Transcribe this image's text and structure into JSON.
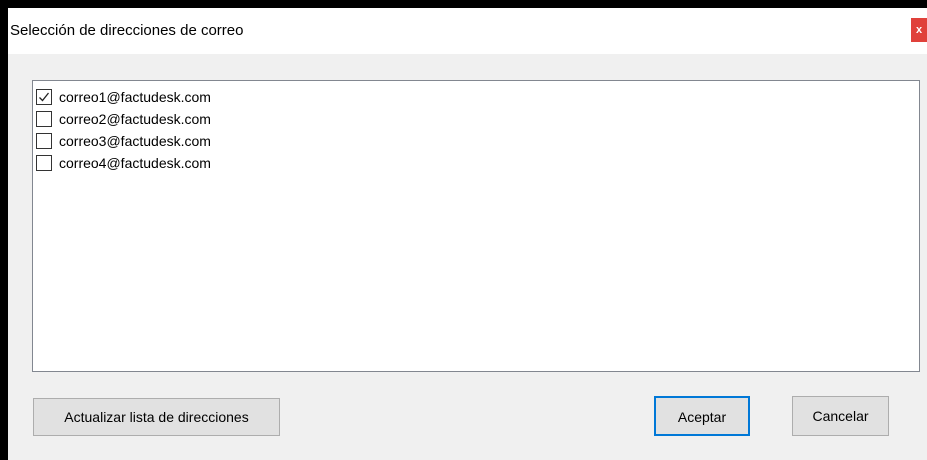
{
  "window": {
    "title": "Selección de direcciones de correo",
    "close_label": "x",
    "colors": {
      "close_bg": "#e0413b",
      "focus_border": "#0078d7"
    }
  },
  "list": {
    "items": [
      {
        "label": "correo1@factudesk.com",
        "checked": true
      },
      {
        "label": "correo2@factudesk.com",
        "checked": false
      },
      {
        "label": "correo3@factudesk.com",
        "checked": false
      },
      {
        "label": "correo4@factudesk.com",
        "checked": false
      }
    ]
  },
  "buttons": {
    "refresh_label": "Actualizar lista de direcciones",
    "accept_label": "Aceptar",
    "cancel_label": "Cancelar"
  },
  "icons": {
    "check": "checkmark-icon",
    "close": "close-icon"
  }
}
